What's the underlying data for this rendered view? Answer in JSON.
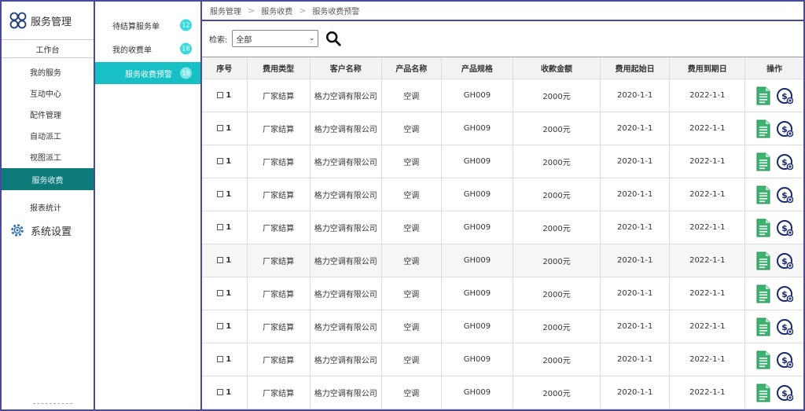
{
  "app": {
    "title": "服务管理",
    "workbench": "工作台"
  },
  "left_nav": {
    "items": [
      {
        "label": "我的服务"
      },
      {
        "label": "互动中心"
      },
      {
        "label": "配件管理"
      },
      {
        "label": "自动派工"
      },
      {
        "label": "视图派工"
      },
      {
        "label": "服务收费",
        "active": true
      },
      {
        "label": "报表统计"
      }
    ],
    "system_settings": "系统设置"
  },
  "sub_nav": {
    "items": [
      {
        "label": "待结算服务单",
        "badge": "12"
      },
      {
        "label": "我的收费单",
        "badge": "18"
      },
      {
        "label": "服务收费预警",
        "badge": "18",
        "active": true
      }
    ]
  },
  "breadcrumb": [
    "服务管理",
    "服务收费",
    "服务收费预警"
  ],
  "search": {
    "label": "检索:",
    "selected": "全部"
  },
  "table": {
    "headers": [
      "序号",
      "费用类型",
      "客户名称",
      "产品名称",
      "产品规格",
      "收款金额",
      "费用起始日",
      "费用到期日",
      "操作"
    ],
    "rows": [
      [
        "1",
        "厂家结算",
        "格力空调有限公司",
        "空调",
        "GH009",
        "2000元",
        "2020-1-1",
        "2022-1-1"
      ],
      [
        "1",
        "厂家结算",
        "格力空调有限公司",
        "空调",
        "GH009",
        "2000元",
        "2020-1-1",
        "2022-1-1"
      ],
      [
        "1",
        "厂家结算",
        "格力空调有限公司",
        "空调",
        "GH009",
        "2000元",
        "2020-1-1",
        "2022-1-1"
      ],
      [
        "1",
        "厂家结算",
        "格力空调有限公司",
        "空调",
        "GH009",
        "2000元",
        "2020-1-1",
        "2022-1-1"
      ],
      [
        "1",
        "厂家结算",
        "格力空调有限公司",
        "空调",
        "GH009",
        "2000元",
        "2020-1-1",
        "2022-1-1"
      ],
      [
        "1",
        "厂家结算",
        "格力空调有限公司",
        "空调",
        "GH009",
        "2000元",
        "2020-1-1",
        "2022-1-1"
      ],
      [
        "1",
        "厂家结算",
        "格力空调有限公司",
        "空调",
        "GH009",
        "2000元",
        "2020-1-1",
        "2022-1-1"
      ],
      [
        "1",
        "厂家结算",
        "格力空调有限公司",
        "空调",
        "GH009",
        "2000元",
        "2020-1-1",
        "2022-1-1"
      ],
      [
        "1",
        "厂家结算",
        "格力空调有限公司",
        "空调",
        "GH009",
        "2000元",
        "2020-1-1",
        "2022-1-1"
      ],
      [
        "1",
        "厂家结算",
        "格力空调有限公司",
        "空调",
        "GH009",
        "2000元",
        "2020-1-1",
        "2022-1-1"
      ]
    ]
  },
  "icons": {
    "document": "document-icon",
    "payment": "payment-icon"
  },
  "colors": {
    "active_nav": "#0f7a7a",
    "active_sub": "#16c0c4",
    "badge": "#3ad9dd",
    "frame": "#4a4a9a",
    "doc_green": "#3cb371",
    "pay_navy": "#1a2a6c"
  }
}
